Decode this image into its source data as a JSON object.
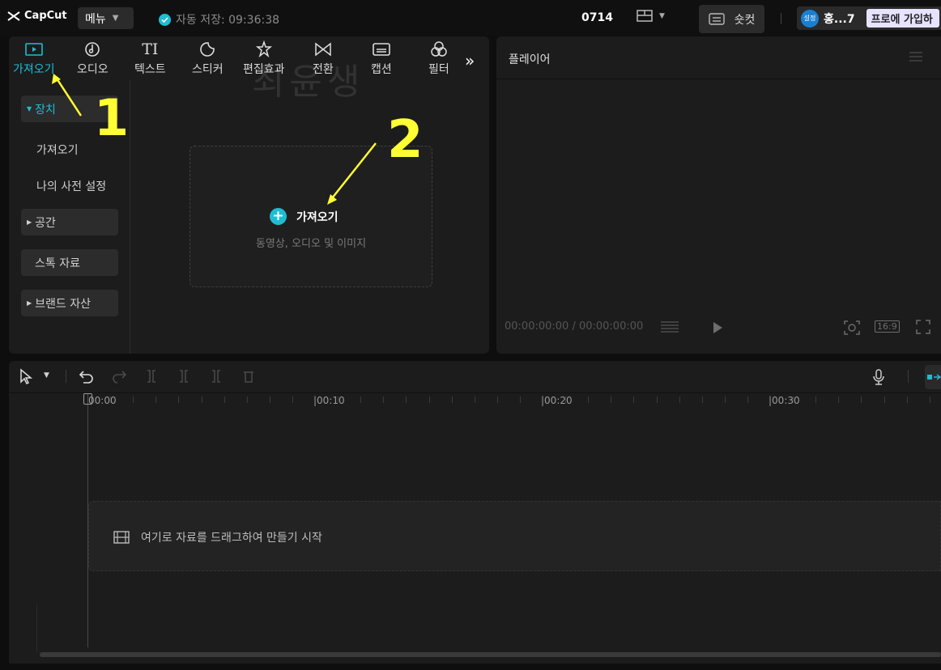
{
  "topbar": {
    "logo_text": "CapCut",
    "menu_label": "메뉴",
    "autosave_text": "자동 저장: 09:36:38",
    "project_name": "0714",
    "shortcut_label": "숏컷",
    "avatar_text": "설정",
    "username": "홍...7",
    "pro_badge": "프로에 가입하"
  },
  "media": {
    "tabs": [
      {
        "label": "가져오기",
        "icon": "media-icon"
      },
      {
        "label": "오디오",
        "icon": "audio-icon"
      },
      {
        "label": "텍스트",
        "icon": "text-icon"
      },
      {
        "label": "스티커",
        "icon": "sticker-icon"
      },
      {
        "label": "편집효과",
        "icon": "effects-icon"
      },
      {
        "label": "전환",
        "icon": "transition-icon"
      },
      {
        "label": "캡션",
        "icon": "caption-icon"
      },
      {
        "label": "필터",
        "icon": "filter-icon"
      }
    ],
    "sidebar": {
      "device": "장치",
      "import": "가져오기",
      "my_presets": "나의 사전 설정",
      "space": "공간",
      "stock": "스톡 자료",
      "brand": "브랜드 자산"
    },
    "import_box": {
      "title": "가져오기",
      "subtitle": "동영상, 오디오 및 이미지"
    }
  },
  "annotations": {
    "step1": "1",
    "step2": "2",
    "color": "#ffff33"
  },
  "watermark": "최윤생",
  "player": {
    "title": "플레이어",
    "timecode": "00:00:00:00 / 00:00:00:00",
    "ratio": "16:9"
  },
  "timeline": {
    "ruler_labels": [
      "00:00",
      "|00:10",
      "|00:20",
      "|00:30"
    ],
    "drop_text": "여기로 자료를 드래그하여 만들기 시작"
  },
  "colors": {
    "accent": "#1ebdd4",
    "panel": "#1c1c1c",
    "background": "#0e0e0e"
  }
}
